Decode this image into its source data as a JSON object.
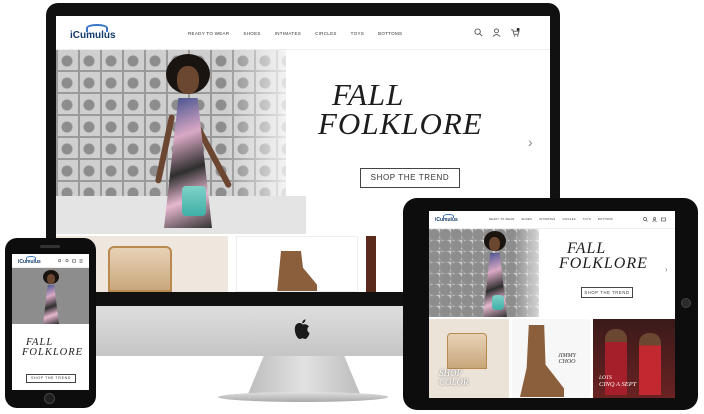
{
  "brand": {
    "logo_text": "iCumulus"
  },
  "nav": {
    "items": [
      "READY TO WEAR",
      "SHOES",
      "INTIMATES",
      "CIRCLES",
      "TOYS",
      "BOTTOMS"
    ]
  },
  "header_icons": [
    "search-icon",
    "user-icon",
    "cart-icon"
  ],
  "hero": {
    "headline_line1": "FALL",
    "headline_line2": "FOLKLORE",
    "cta_label": "SHOP THE TREND"
  },
  "ipad_tiles": [
    {
      "caption_line1": "SHOP",
      "caption_line2": "COLOR"
    },
    {
      "caption_line1": "JIMMY",
      "caption_line2": "CHOO"
    },
    {
      "caption_line1": "LOTS",
      "caption_line2": "CINQ A SEPT"
    }
  ],
  "colors": {
    "brand_navy": "#123a6b",
    "brand_blue": "#3a74c4",
    "device_black": "#0d0d0d",
    "imac_silver": "#d0d0d0"
  }
}
